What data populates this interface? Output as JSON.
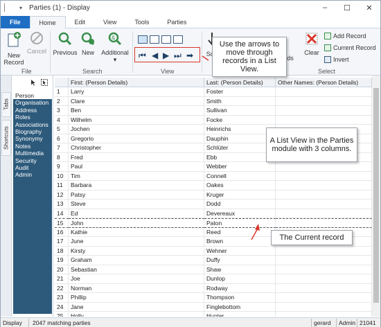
{
  "window": {
    "title": "Parties (1) - Display",
    "quick_access": "▾",
    "minimize_glyph": "–",
    "maximize_glyph": "☐",
    "close_glyph": "✕"
  },
  "tabs": [
    {
      "label": "File"
    },
    {
      "label": "Home"
    },
    {
      "label": "Edit"
    },
    {
      "label": "View"
    },
    {
      "label": "Tools"
    },
    {
      "label": "Parties"
    }
  ],
  "ribbon": {
    "file_group": {
      "new_record": "New Record",
      "cancel": "Cancel",
      "label": "File"
    },
    "search_group": {
      "previous": "Previous",
      "new": "New",
      "additional": "Additional",
      "additional_caret": "▾",
      "label": "Search"
    },
    "view_group": {
      "label": "View"
    },
    "sort_label": "Sort",
    "records_label": "ords",
    "select_group": {
      "clear": "Clear",
      "add_record": "Add Record",
      "current_record": "Current Record",
      "invert": "Invert",
      "label": "Select"
    },
    "nav_arrows": {
      "first": "⏮",
      "prev": "◀",
      "next": "▶",
      "last": "⏭",
      "jump": "➡"
    }
  },
  "side_tabs": {
    "tabs": "Tabs",
    "shortcuts": "Shortcuts"
  },
  "sidebar": {
    "items": [
      "Person",
      "Organisation",
      "Address",
      "Roles",
      "Associations",
      "Biography",
      "Synonymy",
      "Notes",
      "Multimedia",
      "Security",
      "Audit",
      "Admin"
    ]
  },
  "grid": {
    "columns": [
      "First: (Person Details)",
      "Last: (Person Details)",
      "Other Names: (Person Details)"
    ],
    "rows": [
      [
        "1",
        "Larry",
        "Foster"
      ],
      [
        "2",
        "Clare",
        "Smith"
      ],
      [
        "3",
        "Ben",
        "Sullivan"
      ],
      [
        "4",
        "Wilhelm",
        "Focke"
      ],
      [
        "5",
        "Jochen",
        "Heinrichs"
      ],
      [
        "6",
        "Gregorio",
        "Dauphin"
      ],
      [
        "7",
        "Christopher",
        "Schlüter"
      ],
      [
        "8",
        "Fred",
        "Ebb"
      ],
      [
        "9",
        "Paul",
        "Webber"
      ],
      [
        "10",
        "Tim",
        "Connell"
      ],
      [
        "11",
        "Barbara",
        "Oakes"
      ],
      [
        "12",
        "Patsy",
        "Kruger"
      ],
      [
        "13",
        "Steve",
        "Dodd"
      ],
      [
        "14",
        "Ed",
        "Devereaux"
      ],
      [
        "15",
        "John",
        "Paton"
      ],
      [
        "16",
        "Kathie",
        "Reed"
      ],
      [
        "17",
        "June",
        "Brown"
      ],
      [
        "18",
        "Kirsty",
        "Wehner"
      ],
      [
        "19",
        "Graham",
        "Duffy"
      ],
      [
        "20",
        "Sebastian",
        "Shaw"
      ],
      [
        "21",
        "Joe",
        "Dunlop"
      ],
      [
        "22",
        "Norman",
        "Rodway"
      ],
      [
        "23",
        "Phillip",
        "Thompson"
      ],
      [
        "24",
        "Jane",
        "Finglebottom"
      ],
      [
        "25",
        "Holly",
        "Hunter"
      ]
    ],
    "current_row": 15
  },
  "callouts": {
    "arrows": "Use the arrows to move through records in a List View.",
    "list_view": "A List View in the Parties module with 3 columns.",
    "current": "The Current record"
  },
  "status": {
    "mode": "Display",
    "count": "2047 matching parties",
    "user": "gerard",
    "role": "Admin",
    "code": "21041"
  },
  "colors": {
    "accent": "#1e6fc4",
    "sidebar_bg": "#2d5a7b",
    "highlight_red": "#d9352b"
  }
}
